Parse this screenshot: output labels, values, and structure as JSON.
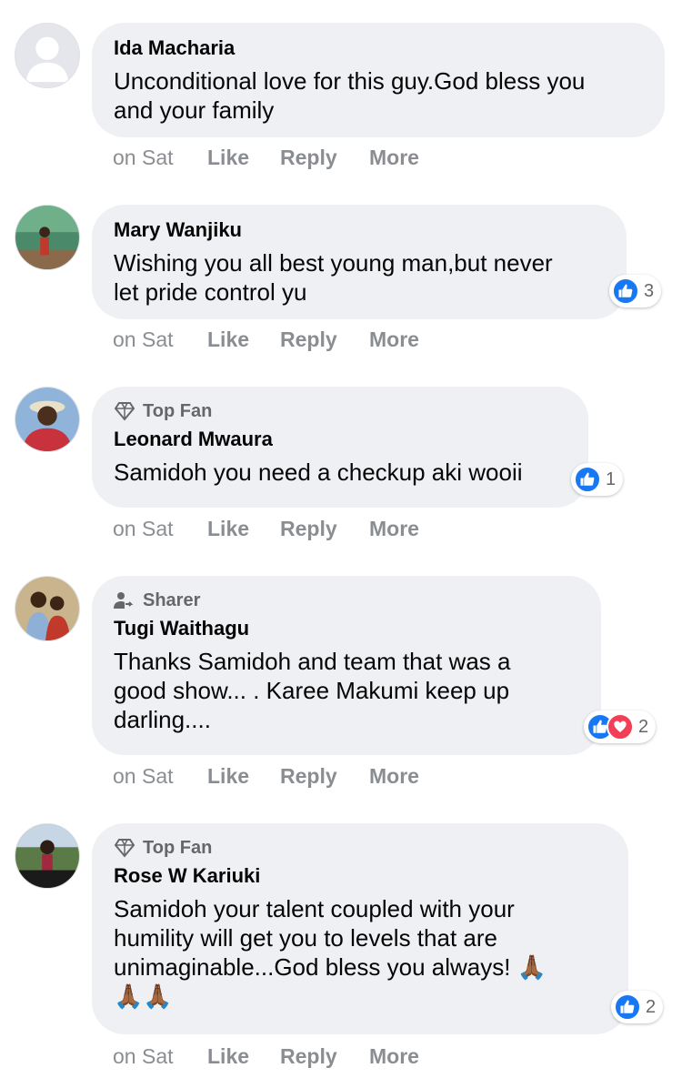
{
  "comments": [
    {
      "badge": "",
      "name": "Ida Macharia",
      "text": "Unconditional love for this guy.God bless you\nand your family",
      "time": "on Sat",
      "like": "Like",
      "reply": "Reply",
      "more": "More",
      "reaction_count": ""
    },
    {
      "badge": "",
      "name": "Mary Wanjiku",
      "text": "Wishing you all best young man,but never\nlet pride control yu",
      "time": "on Sat",
      "like": "Like",
      "reply": "Reply",
      "more": "More",
      "reaction_count": "3"
    },
    {
      "badge": "Top Fan",
      "name": "Leonard Mwaura",
      "text": "Samidoh you need a checkup aki wooii",
      "time": "on Sat",
      "like": "Like",
      "reply": "Reply",
      "more": "More",
      "reaction_count": "1"
    },
    {
      "badge": "Sharer",
      "name": "Tugi Waithagu",
      "text": "Thanks Samidoh and team that was a\ngood show... . Karee Makumi keep up\ndarling....",
      "time": "on Sat",
      "like": "Like",
      "reply": "Reply",
      "more": "More",
      "reaction_count": "2"
    },
    {
      "badge": "Top Fan",
      "name": "Rose W Kariuki",
      "text": "Samidoh your talent coupled with your\nhumility will get you to levels that are\nunimaginable...God bless you always!",
      "emoji": "🙏🏾",
      "time": "on Sat",
      "like": "Like",
      "reply": "Reply",
      "more": "More",
      "reaction_count": "2"
    }
  ],
  "colors": {
    "bubble": "#eef0f3",
    "like_blue": "#1877f2",
    "love_red": "#f33e58",
    "meta_gray": "#8a8d91"
  }
}
